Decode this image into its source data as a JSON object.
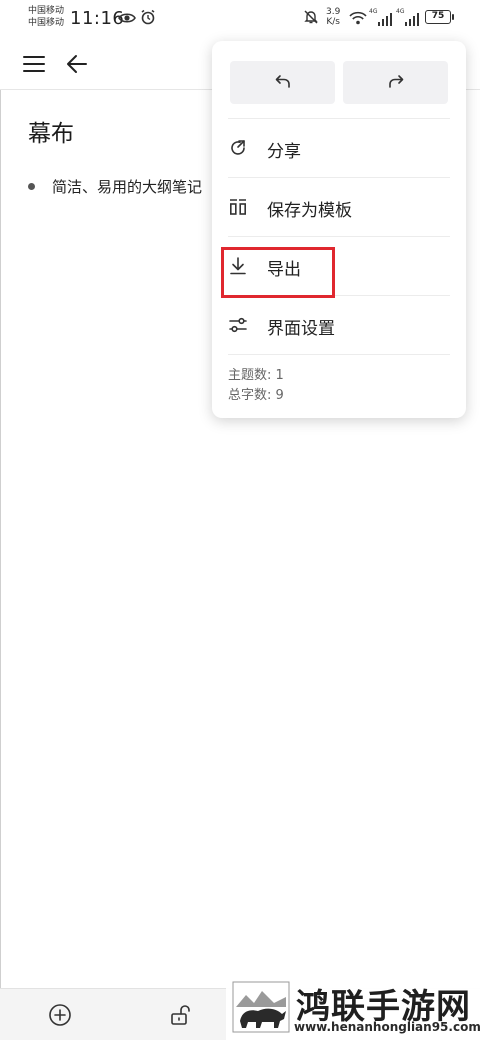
{
  "status_bar": {
    "carrier_1": "中国移动",
    "carrier_2": "中国移动",
    "time": "11:16",
    "net_speed_value": "3.9",
    "net_speed_unit": "K/s",
    "network_1": "4G",
    "network_2": "4G",
    "battery": "75"
  },
  "toolbar": {
    "menu_icon": "hamburger-icon",
    "back_icon": "arrow-left-icon"
  },
  "document": {
    "title": "幕布",
    "bullets": [
      "简洁、易用的大纲笔记"
    ]
  },
  "popup_menu": {
    "undo_icon": "undo-icon",
    "redo_icon": "redo-icon",
    "items": [
      {
        "label": "分享",
        "icon": "share-icon"
      },
      {
        "label": "保存为模板",
        "icon": "template-icon"
      },
      {
        "label": "导出",
        "icon": "download-icon"
      },
      {
        "label": "界面设置",
        "icon": "sliders-icon"
      }
    ],
    "stats": {
      "topics_label": "主题数: 1",
      "chars_label": "总字数: 9"
    },
    "highlighted_item": "导出",
    "highlight_color": "#e0272f"
  },
  "bottom_bar": {
    "add_icon": "plus-circle-icon",
    "lock_icon": "unlock-icon"
  },
  "watermark": {
    "name": "鸿联手游网",
    "url": "www.henanhonglian95.com"
  }
}
